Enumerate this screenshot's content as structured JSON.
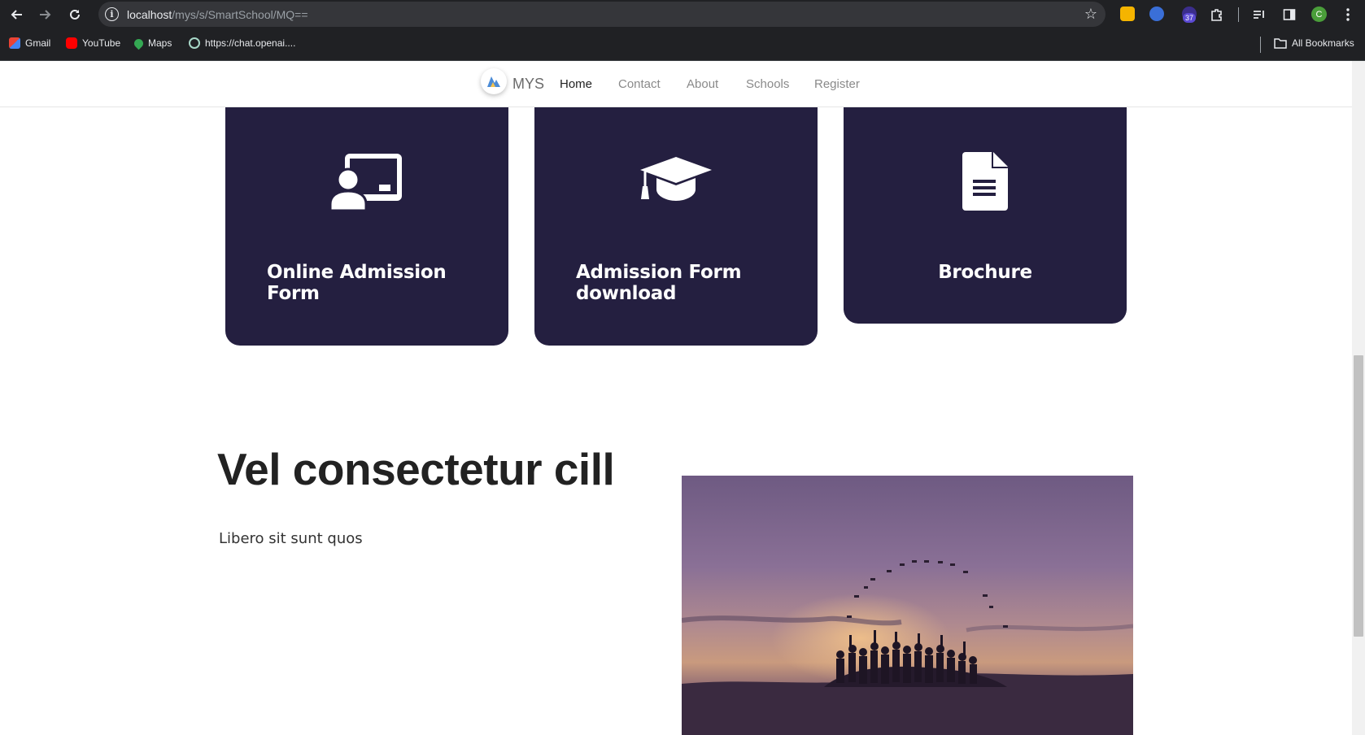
{
  "browser": {
    "url_host": "localhost",
    "url_path": "/mys/s/SmartSchool/MQ==",
    "extension_badge": "37",
    "profile_initial": "C",
    "bookmarks": [
      {
        "label": "Gmail"
      },
      {
        "label": "YouTube"
      },
      {
        "label": "Maps"
      },
      {
        "label": "https://chat.openai...."
      }
    ],
    "all_bookmarks_label": "All Bookmarks"
  },
  "navbar": {
    "brand": "MYS",
    "links": [
      {
        "label": "Home",
        "active": true
      },
      {
        "label": "Contact",
        "active": false
      },
      {
        "label": "About",
        "active": false
      },
      {
        "label": "Schools",
        "active": false
      },
      {
        "label": "Register",
        "active": false
      }
    ]
  },
  "cards": [
    {
      "title": "Online Admission Form",
      "icon": "teacher-icon"
    },
    {
      "title": "Admission Form download",
      "icon": "graduation-cap-icon"
    },
    {
      "title": "Brochure",
      "icon": "document-icon"
    }
  ],
  "section": {
    "headline": "Vel consectetur cill",
    "lead": "Libero sit sunt quos",
    "image": "graduation-silhouette-photo"
  },
  "colors": {
    "card_bg": "#241f40",
    "chrome_bg": "#202124"
  }
}
